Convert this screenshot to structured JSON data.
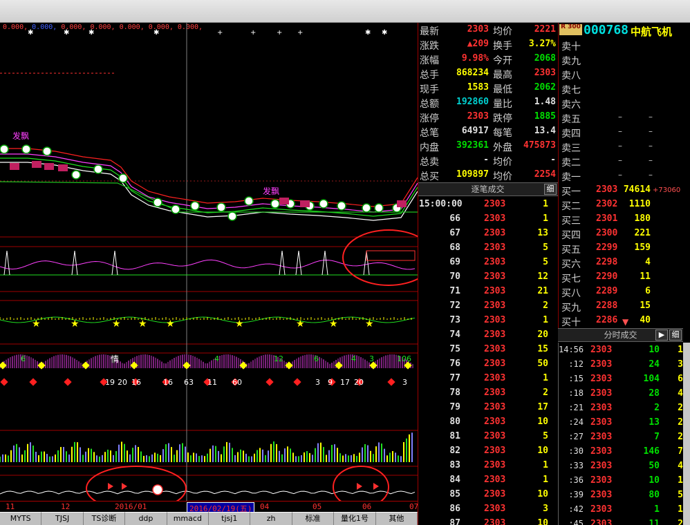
{
  "indicator_text": {
    "red": "0.000, ",
    "blue": "0.000, ",
    "rest": "0.000, 0.000, 0.000, 0.000, 0.000,"
  },
  "chart_labels": {
    "fa_piao_1": "发飘",
    "fa_piao_2": "发飘",
    "qing": "情",
    "nums_row": [
      "19",
      "20",
      "16",
      "16",
      "63",
      "11",
      "60",
      "3",
      "9",
      "17",
      "20",
      "3",
      "6",
      "4",
      "12",
      "6",
      "4",
      "3",
      "106"
    ]
  },
  "date_axis": {
    "labels": [
      "11",
      "12",
      "2016/01",
      "04",
      "05",
      "06",
      "07"
    ],
    "cursor": "2016/02/19(五)"
  },
  "bottom_tabs": [
    "MYTS",
    "TJSJ",
    "TS诊断",
    "ddp",
    "mmacd",
    "tjsj1",
    "zh",
    "标准",
    "量化1号",
    "其他"
  ],
  "stock": {
    "badge": "R 300",
    "code": "000768",
    "name": "中航飞机"
  },
  "quote": [
    {
      "l1": "最新",
      "v1": "2303",
      "c1": "red",
      "l2": "均价",
      "v2": "2221",
      "c2": "red"
    },
    {
      "l1": "涨跌",
      "v1": "▲209",
      "c1": "red",
      "l2": "换手",
      "v2": "3.27%",
      "c2": "yellow"
    },
    {
      "l1": "涨幅",
      "v1": "9.98%",
      "c1": "red",
      "l2": "今开",
      "v2": "2068",
      "c2": "green"
    },
    {
      "l1": "总手",
      "v1": "868234",
      "c1": "yellow",
      "l2": "最高",
      "v2": "2303",
      "c2": "red"
    },
    {
      "l1": "现手",
      "v1": "1583",
      "c1": "yellow",
      "l2": "最低",
      "v2": "2062",
      "c2": "green"
    },
    {
      "l1": "总额",
      "v1": "192860",
      "c1": "cyan",
      "l2": "量比",
      "v2": "1.48",
      "c2": "white"
    },
    {
      "l1": "涨停",
      "v1": "2303",
      "c1": "red",
      "l2": "跌停",
      "v2": "1885",
      "c2": "green"
    },
    {
      "l1": "总笔",
      "v1": "64917",
      "c1": "white",
      "l2": "每笔",
      "v2": "13.4",
      "c2": "white"
    },
    {
      "l1": "内盘",
      "v1": "392361",
      "c1": "green",
      "l2": "外盘",
      "v2": "475873",
      "c2": "red"
    },
    {
      "l1": "总卖",
      "v1": "-",
      "c1": "white",
      "l2": "均价",
      "v2": "-",
      "c2": "white"
    },
    {
      "l1": "总买",
      "v1": "109897",
      "c1": "yellow",
      "l2": "均价",
      "v2": "2254",
      "c2": "red"
    }
  ],
  "trades_header": {
    "title": "逐笔成交",
    "btn": "细"
  },
  "trades": [
    {
      "t": "15:00:00",
      "p": "2303",
      "v": "1"
    },
    {
      "t": "66",
      "p": "2303",
      "v": "1"
    },
    {
      "t": "67",
      "p": "2303",
      "v": "13"
    },
    {
      "t": "68",
      "p": "2303",
      "v": "5"
    },
    {
      "t": "69",
      "p": "2303",
      "v": "5"
    },
    {
      "t": "70",
      "p": "2303",
      "v": "12"
    },
    {
      "t": "71",
      "p": "2303",
      "v": "21"
    },
    {
      "t": "72",
      "p": "2303",
      "v": "2"
    },
    {
      "t": "73",
      "p": "2303",
      "v": "1"
    },
    {
      "t": "74",
      "p": "2303",
      "v": "20"
    },
    {
      "t": "75",
      "p": "2303",
      "v": "15"
    },
    {
      "t": "76",
      "p": "2303",
      "v": "50"
    },
    {
      "t": "77",
      "p": "2303",
      "v": "1"
    },
    {
      "t": "78",
      "p": "2303",
      "v": "2"
    },
    {
      "t": "79",
      "p": "2303",
      "v": "17"
    },
    {
      "t": "80",
      "p": "2303",
      "v": "10"
    },
    {
      "t": "81",
      "p": "2303",
      "v": "5"
    },
    {
      "t": "82",
      "p": "2303",
      "v": "10"
    },
    {
      "t": "83",
      "p": "2303",
      "v": "1"
    },
    {
      "t": "84",
      "p": "2303",
      "v": "1"
    },
    {
      "t": "85",
      "p": "2303",
      "v": "10"
    },
    {
      "t": "86",
      "p": "2303",
      "v": "3"
    },
    {
      "t": "87",
      "p": "2303",
      "v": "10"
    }
  ],
  "sell_book": [
    {
      "l": "卖十",
      "p": "",
      "v": ""
    },
    {
      "l": "卖九",
      "p": "",
      "v": ""
    },
    {
      "l": "卖八",
      "p": "",
      "v": ""
    },
    {
      "l": "卖七",
      "p": "",
      "v": ""
    },
    {
      "l": "卖六",
      "p": "",
      "v": ""
    },
    {
      "l": "卖五",
      "p": "–",
      "v": "–"
    },
    {
      "l": "卖四",
      "p": "–",
      "v": "–"
    },
    {
      "l": "卖三",
      "p": "–",
      "v": "–"
    },
    {
      "l": "卖二",
      "p": "–",
      "v": "–"
    },
    {
      "l": "卖一",
      "p": "–",
      "v": "–"
    }
  ],
  "buy_book": [
    {
      "l": "买一",
      "p": "2303",
      "v": "74614",
      "x": "+73060"
    },
    {
      "l": "买二",
      "p": "2302",
      "v": "1110"
    },
    {
      "l": "买三",
      "p": "2301",
      "v": "180"
    },
    {
      "l": "买四",
      "p": "2300",
      "v": "221"
    },
    {
      "l": "买五",
      "p": "2299",
      "v": "159"
    },
    {
      "l": "买六",
      "p": "2298",
      "v": "4"
    },
    {
      "l": "买七",
      "p": "2290",
      "v": "11"
    },
    {
      "l": "买八",
      "p": "2289",
      "v": "6"
    },
    {
      "l": "买九",
      "p": "2288",
      "v": "15"
    },
    {
      "l": "买十",
      "p": "2286",
      "v": "40",
      "x": "▼"
    }
  ],
  "split_header": {
    "title": "分时成交",
    "btn1": "▶",
    "btn2": "细"
  },
  "split_trades": [
    {
      "t": "14:56",
      "p": "2303",
      "v": "10",
      "n": "1"
    },
    {
      "t": ":12",
      "p": "2303",
      "v": "24",
      "n": "3"
    },
    {
      "t": ":15",
      "p": "2303",
      "v": "104",
      "n": "6"
    },
    {
      "t": ":18",
      "p": "2303",
      "v": "28",
      "n": "4"
    },
    {
      "t": ":21",
      "p": "2303",
      "v": "2",
      "n": "2"
    },
    {
      "t": ":24",
      "p": "2303",
      "v": "13",
      "n": "2"
    },
    {
      "t": ":27",
      "p": "2303",
      "v": "7",
      "n": "2"
    },
    {
      "t": ":30",
      "p": "2303",
      "v": "146",
      "n": "7"
    },
    {
      "t": ":33",
      "p": "2303",
      "v": "50",
      "n": "4"
    },
    {
      "t": ":36",
      "p": "2303",
      "v": "10",
      "n": "1"
    },
    {
      "t": ":39",
      "p": "2303",
      "v": "80",
      "n": "5"
    },
    {
      "t": ":42",
      "p": "2303",
      "v": "1",
      "n": "1"
    },
    {
      "t": ":45",
      "p": "2303",
      "v": "11",
      "n": "2"
    }
  ]
}
